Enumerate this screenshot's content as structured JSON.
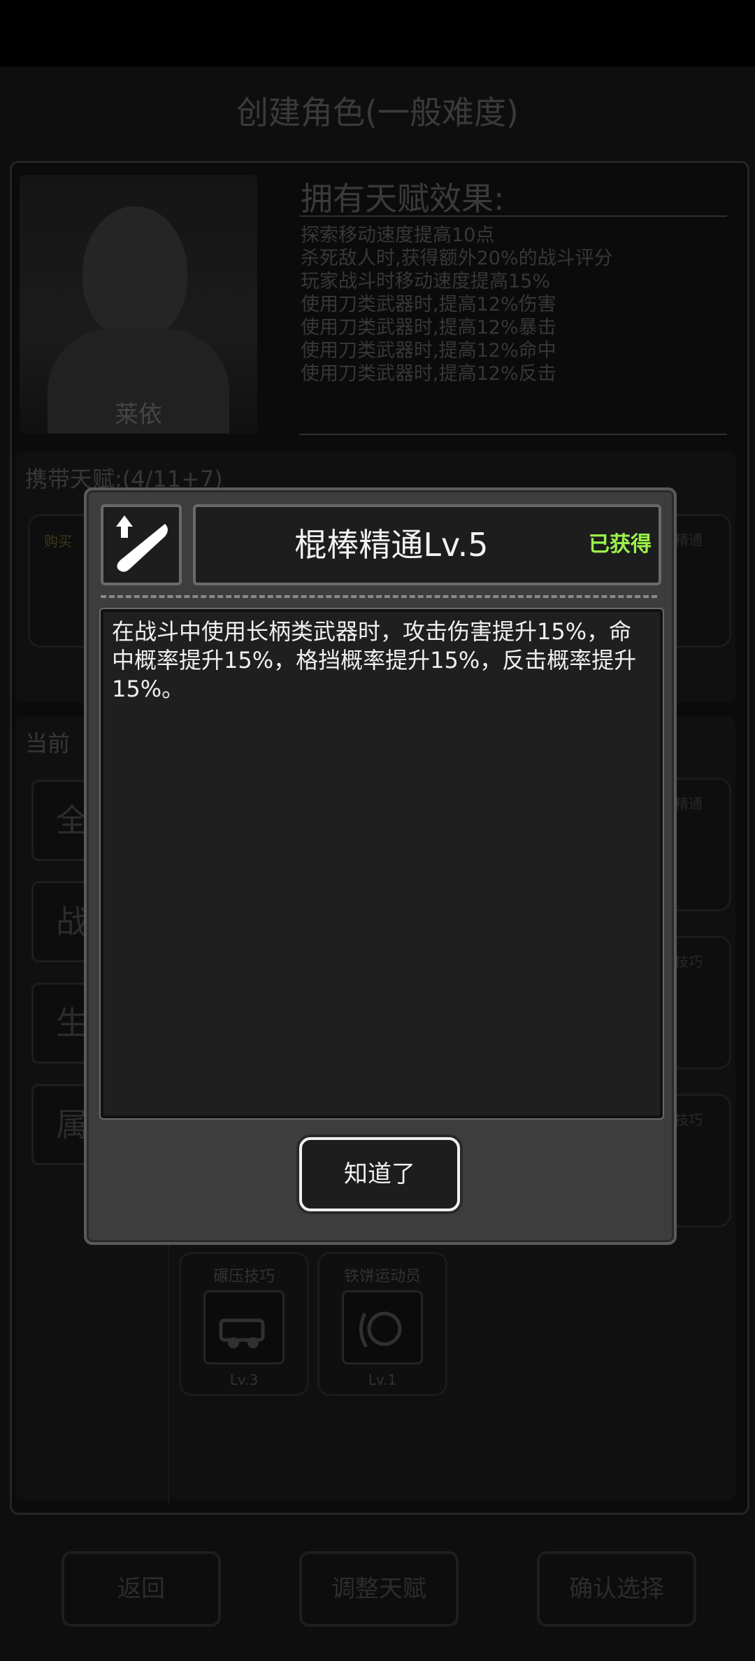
{
  "header": {
    "title": "创建角色(一般难度)"
  },
  "character": {
    "name": "莱依"
  },
  "talents": {
    "heading": "拥有天赋效果:",
    "effects": [
      "探索移动速度提高10点",
      "杀死敌人时,获得额外20%的战斗评分",
      "玩家战斗时移动速度提高15%",
      "使用刀类武器时,提高12%伤害",
      "使用刀类武器时,提高12%暴击",
      "使用刀类武器时,提高12%命中",
      "使用刀类武器时,提高12%反击"
    ],
    "carry_label": "携带天赋:(4/11+7)",
    "buy_label": "购买",
    "current_label": "当前",
    "right_card_labels": [
      "精通",
      "精通",
      "技巧",
      "技巧"
    ]
  },
  "categories": [
    "全",
    "战",
    "生",
    "属"
  ],
  "skills": [
    {
      "name": "碾压技巧",
      "level": "Lv.3",
      "icon": "car-icon"
    },
    {
      "name": "铁饼运动员",
      "level": "Lv.1",
      "icon": "discus-icon"
    }
  ],
  "bottom_buttons": {
    "back": "返回",
    "adjust": "调整天赋",
    "confirm": "确认选择"
  },
  "modal": {
    "skill_name": "棍棒精通Lv.5",
    "status": "已获得",
    "description": "在战斗中使用长柄类武器时，攻击伤害提升15%，命中概率提升15%，格挡概率提升15%，反击概率提升15%。",
    "ok_label": "知道了",
    "icon": "bat-upgrade-icon",
    "status_color": "#9cf24a"
  }
}
